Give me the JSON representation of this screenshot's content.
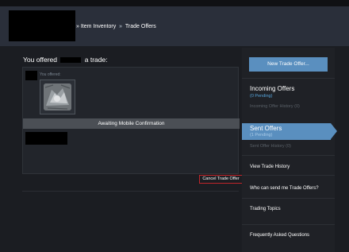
{
  "breadcrumb": {
    "item_inventory": "Item Inventory",
    "separator": "»",
    "trade_offers": "Trade Offers"
  },
  "offer": {
    "prefix": "You offered",
    "suffix": "a trade:",
    "you_offered_label": "You offered:",
    "status": "Awaiting Mobile Confirmation",
    "cancel_label": "Cancel Trade Offer"
  },
  "sidebar": {
    "new_offer": "New Trade Offer...",
    "incoming_title": "Incoming Offers",
    "incoming_pending": "(0 Pending)",
    "incoming_history": "Incoming Offer History (0)",
    "sent_title": "Sent Offers",
    "sent_pending": "(1 Pending)",
    "sent_history": "Sent Offer History (0)",
    "view_history": "View Trade History",
    "who_can_send": "Who can send me Trade Offers?",
    "trading_topics": "Trading Topics",
    "faq": "Frequently Asked Questions"
  },
  "colors": {
    "accent": "#5a8fbf",
    "cancel_border": "#c0252a",
    "pending": "#57a6dc"
  }
}
